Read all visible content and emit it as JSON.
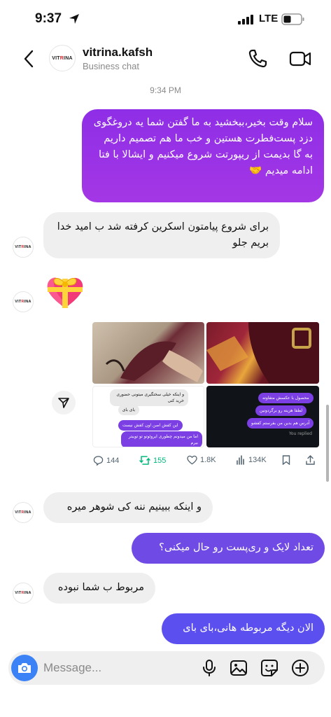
{
  "status_bar": {
    "time": "9:37",
    "network": "LTE"
  },
  "header": {
    "name": "vitrina.kafsh",
    "subtitle": "Business chat",
    "logo_text_a": "VIT",
    "logo_text_b": "R",
    "logo_text_c": "INA"
  },
  "timestamp": "9:34 PM",
  "messages": {
    "out_1": "سلام وقت بخیر،ببخشید به ما گفتن شما یه دروغگوی دزد پست‌فطرت هستین و خب ما هم تصمیم داریم به گا بدیمت از ریپورتت شروع میکنیم و ایشالا با فتا ادامه میدیم 🤝",
    "in_1": "برای شروع پیامتون اسکرین کرفته شد ب امید خدا بریم جلو",
    "sticker": "💝",
    "in_2": "و اینکه ببینیم ننه کی شوهر میره",
    "out_2": "تعداد لایک و ری‌پست رو حال میکنی؟",
    "in_3": "مربوط ب شما نبوده",
    "out_3": "الان دیگه مربوطه هانی،بای بای"
  },
  "shared_post": {
    "panel_c_bubble_1": "و اینکه خیلی سختگیری میتونی حضوری خرید کنی",
    "panel_c_bubble_2": "بای بای",
    "panel_c_bubble_3": "این کفش اصن اون کفش نیست",
    "panel_c_bubble_4": "اما من میدونم چطوری ایروئوتو تو تویبتر بیرم",
    "panel_d_bubble_1": "محصول با عکسش متفاوته",
    "panel_d_bubble_2": "لطفا هزینه رو برگردونین",
    "panel_d_bubble_3": "آدرس هم بدین من بفرستم کفشو",
    "panel_d_replied": "You replied",
    "stats": {
      "replies": "144",
      "reposts": "155",
      "likes": "1.8K",
      "views": "134K"
    }
  },
  "composer": {
    "placeholder": "Message..."
  },
  "colors": {
    "bubble_out_top": "#8e2ee6",
    "bubble_out_mid": "#6f4ae4",
    "bubble_out_bottom": "#5b4ff0",
    "bubble_in": "#efefef",
    "camera": "#3b82f6",
    "repost_green": "#00ba7c"
  }
}
